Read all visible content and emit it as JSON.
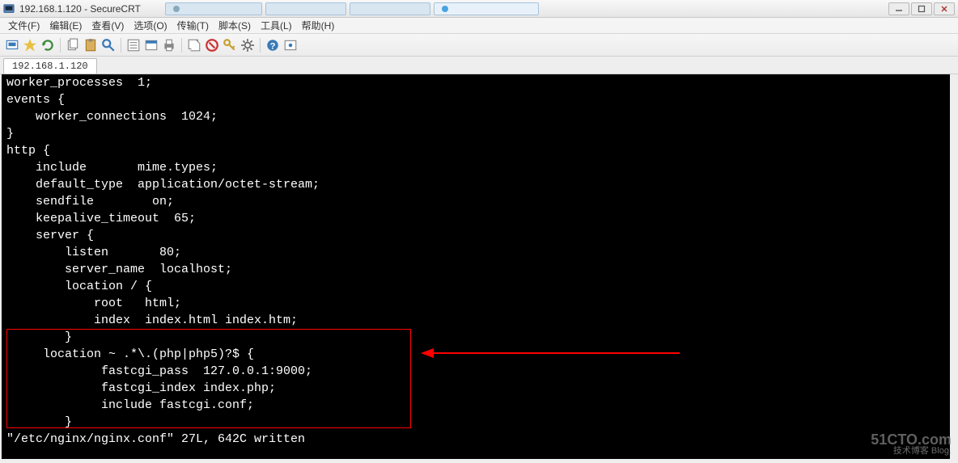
{
  "window": {
    "title": "192.168.1.120 - SecureCRT",
    "browser_tabs": [
      "",
      "",
      "",
      ""
    ],
    "btn_min": "–",
    "btn_max": "□",
    "btn_close": "×"
  },
  "menu": {
    "file": "文件(F)",
    "edit": "编辑(E)",
    "view": "查看(V)",
    "options": "选项(O)",
    "transfer": "传输(T)",
    "script": "脚本(S)",
    "tools": "工具(L)",
    "help": "帮助(H)"
  },
  "session": {
    "tab_label": "192.168.1.120",
    "close_x": "×"
  },
  "terminal": {
    "content": "worker_processes  1;\nevents {\n    worker_connections  1024;\n}\nhttp {\n    include       mime.types;\n    default_type  application/octet-stream;\n    sendfile        on;\n    keepalive_timeout  65;\n    server {\n        listen       80;\n        server_name  localhost;\n        location / {\n            root   html;\n            index  index.html index.htm;\n        }\n     location ~ .*\\.(php|php5)?$ {\n             fastcgi_pass  127.0.0.1:9000;\n             fastcgi_index index.php;\n             include fastcgi.conf;\n        }\n\"/etc/nginx/nginx.conf\" 27L, 642C written"
  },
  "watermark": {
    "line1": "51CTO.com",
    "line2": "技术博客      Blog."
  }
}
